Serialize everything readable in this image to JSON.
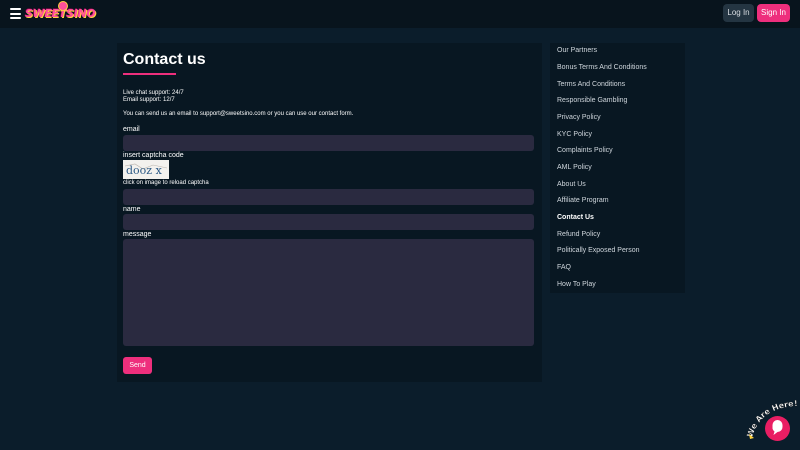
{
  "header": {
    "logo_text": "SWEETSINO",
    "login_label": "Log In",
    "signin_label": "Sign In"
  },
  "main": {
    "title": "Contact us",
    "live_chat": "Live chat support: 24/7",
    "email_support": "Email support: 12/7",
    "intro": "You can send us an email to support@sweetsino.com or you can use our contact form.",
    "form": {
      "email_label": "email",
      "captcha_label": "insert captcha code",
      "captcha_text": "dooz x",
      "captcha_hint": "click on image to reload captcha",
      "name_label": "name",
      "message_label": "message",
      "send_label": "Send"
    }
  },
  "sidebar": {
    "items": [
      {
        "label": "Our Partners"
      },
      {
        "label": "Bonus Terms And Conditions"
      },
      {
        "label": "Terms And Conditions"
      },
      {
        "label": "Responsible Gambling"
      },
      {
        "label": "Privacy Policy"
      },
      {
        "label": "KYC Policy"
      },
      {
        "label": "Complaints Policy"
      },
      {
        "label": "AML Policy"
      },
      {
        "label": "About Us"
      },
      {
        "label": "Affiliate Program"
      },
      {
        "label": "Contact Us"
      },
      {
        "label": "Refund Policy"
      },
      {
        "label": "Politically Exposed Person"
      },
      {
        "label": "FAQ"
      },
      {
        "label": "How To Play"
      }
    ],
    "active_index": 10
  },
  "chat_widget": {
    "text": "We Are Here!",
    "icon": "chat-bubble-icon"
  },
  "colors": {
    "accent": "#ee2f7d",
    "background": "#0b1d2b",
    "panel": "#081722",
    "input": "#2a2a40"
  }
}
